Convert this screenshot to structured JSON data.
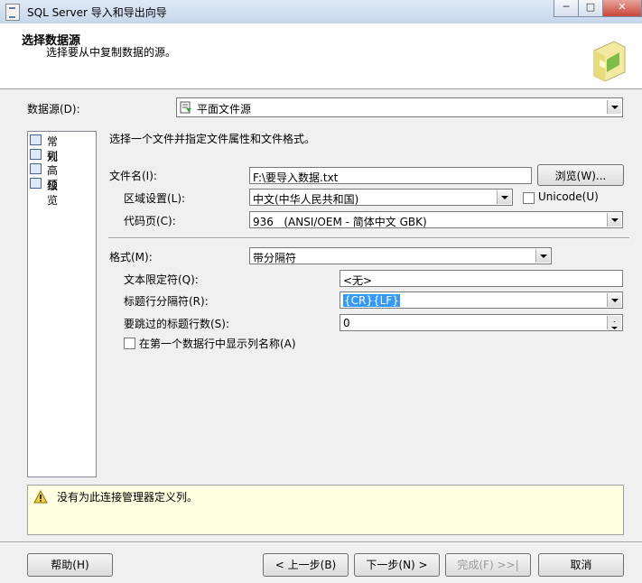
{
  "window": {
    "title": "SQL Server 导入和导出向导",
    "controls": {
      "minimize": "─",
      "maximize": "□",
      "close": "✕"
    }
  },
  "header": {
    "title": "选择数据源",
    "subtitle": "选择要从中复制数据的源。"
  },
  "datasource": {
    "label": "数据源(D):",
    "value": "平面文件源"
  },
  "nav": {
    "items": [
      {
        "label": "常规",
        "icon": "general-icon"
      },
      {
        "label": "列",
        "icon": "columns-icon"
      },
      {
        "label": "高级",
        "icon": "advanced-icon"
      },
      {
        "label": "预览",
        "icon": "preview-icon"
      }
    ]
  },
  "general": {
    "instruction": "选择一个文件并指定文件属性和文件格式。",
    "filename_label": "文件名(I):",
    "filename_value": "F:\\要导入数据.txt",
    "browse_label": "浏览(W)...",
    "locale_label": "区域设置(L):",
    "locale_value": "中文(中华人民共和国)",
    "unicode_label": "Unicode(U)",
    "codepage_label": "代码页(C):",
    "codepage_value": "936   (ANSI/OEM - 简体中文 GBK)",
    "format_label": "格式(M):",
    "format_value": "带分隔符",
    "text_qualifier_label": "文本限定符(Q):",
    "text_qualifier_value": "<无>",
    "header_delim_label": "标题行分隔符(R):",
    "header_delim_value": "{CR}{LF}",
    "skip_rows_label": "要跳过的标题行数(S):",
    "skip_rows_value": "0",
    "first_row_label": "在第一个数据行中显示列名称(A)"
  },
  "message": {
    "text": "没有为此连接管理器定义列。"
  },
  "buttons": {
    "help": "帮助(H)",
    "back": "< 上一步(B)",
    "next": "下一步(N) >",
    "finish": "完成(F) >>|",
    "cancel": "取消"
  },
  "colors": {
    "selection": "#3399ff",
    "message_bg": "#ffffe1",
    "panel_bg": "#f0f0f0"
  }
}
